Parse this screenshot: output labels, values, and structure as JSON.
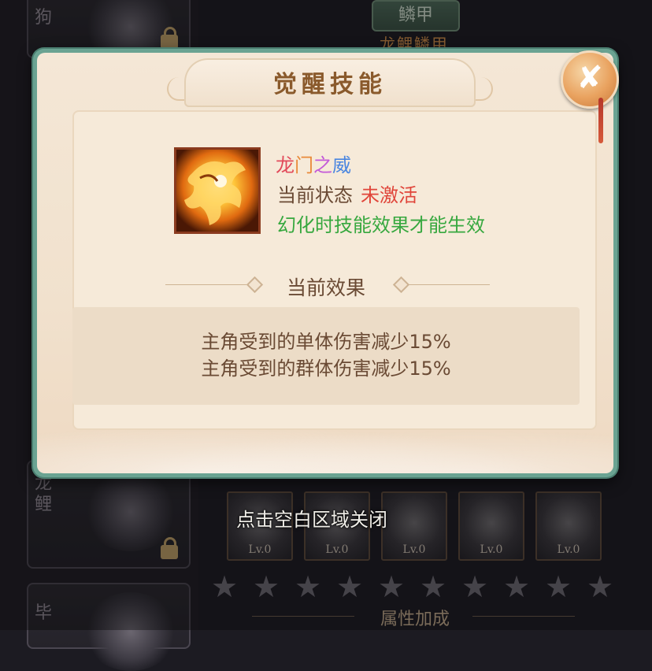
{
  "background": {
    "side_cards": [
      {
        "label": "狗"
      },
      {
        "label": "龙鲤"
      },
      {
        "label": "毕"
      }
    ],
    "top_button_label": "鳞甲",
    "top_sub_label": "龙鲤鳞甲",
    "skill_slots": [
      {
        "level": "Lv.0"
      },
      {
        "level": "Lv.0"
      },
      {
        "level": "Lv.0"
      },
      {
        "level": "Lv.0"
      },
      {
        "level": "Lv.0"
      }
    ],
    "stars_filled": 0,
    "stars_total": 10,
    "section_label": "属性加成"
  },
  "dialog": {
    "title": "觉醒技能",
    "close_icon": "close-brush-icon",
    "skill": {
      "icon": "golden-dragon-icon",
      "name_chars": [
        {
          "text": "龙",
          "color": "#e24a5a"
        },
        {
          "text": "门",
          "color": "#e98a3a"
        },
        {
          "text": "之",
          "color": "#c45ad8"
        },
        {
          "text": "威",
          "color": "#4a86e0"
        }
      ],
      "status_label": "当前状态",
      "status_value": "未激活",
      "note": "幻化时技能效果才能生效"
    },
    "effect_section_title": "当前效果",
    "effects": [
      "主角受到的单体伤害减少15%",
      "主角受到的群体伤害减少15%"
    ]
  },
  "toast": "点击空白区域关闭",
  "colors": {
    "dialog_border": "#6aa392",
    "title_text": "#8a5a2c",
    "status_inactive": "#e0453a",
    "note_green": "#37a83f",
    "body_text": "#6a4a34"
  }
}
